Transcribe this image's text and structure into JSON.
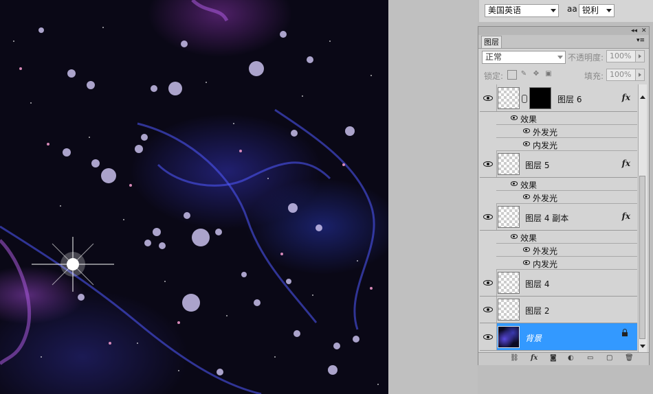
{
  "options_bar": {
    "language": "美国英语",
    "aa_icon": "aa",
    "antialias": "锐利"
  },
  "panel": {
    "collapse_icon": "◂◂",
    "close_icon": "✕",
    "tab_label": "图层",
    "blend_mode": "正常",
    "opacity_label": "不透明度:",
    "opacity_value": "100%",
    "lock_label": "锁定:",
    "fill_label": "填充:",
    "fill_value": "100%"
  },
  "layers": [
    {
      "name": "图层 6",
      "fx": "fx",
      "effects_label": "效果",
      "effects": [
        "外发光",
        "内发光"
      ]
    },
    {
      "name": "图层 5",
      "fx": "fx",
      "effects_label": "效果",
      "effects": [
        "外发光"
      ]
    },
    {
      "name": "图层 4 副本",
      "fx": "fx",
      "effects_label": "效果",
      "effects": [
        "外发光",
        "内发光"
      ]
    },
    {
      "name": "图层 4"
    },
    {
      "name": "图层 2"
    },
    {
      "name": "背景",
      "selected": true,
      "locked": true
    }
  ],
  "accent_color": "#3399ff",
  "icons": [
    "eye-icon",
    "link-icon",
    "lock-icon",
    "fx-icon",
    "mask-icon",
    "adjustment-icon",
    "group-folder-icon",
    "new-layer-icon",
    "trash-icon"
  ]
}
